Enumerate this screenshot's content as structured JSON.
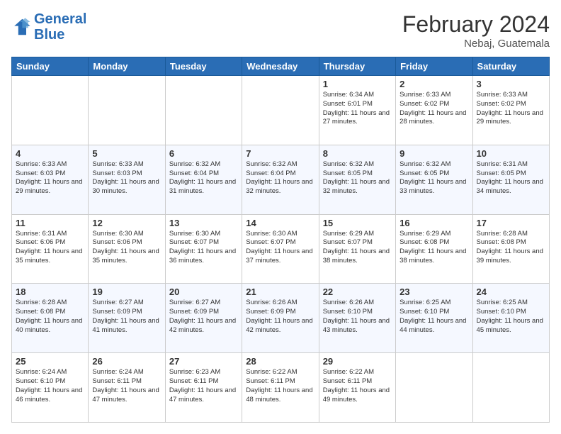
{
  "logo": {
    "line1": "General",
    "line2": "Blue"
  },
  "title": "February 2024",
  "location": "Nebaj, Guatemala",
  "days_of_week": [
    "Sunday",
    "Monday",
    "Tuesday",
    "Wednesday",
    "Thursday",
    "Friday",
    "Saturday"
  ],
  "weeks": [
    [
      {
        "day": "",
        "info": ""
      },
      {
        "day": "",
        "info": ""
      },
      {
        "day": "",
        "info": ""
      },
      {
        "day": "",
        "info": ""
      },
      {
        "day": "1",
        "info": "Sunrise: 6:34 AM\nSunset: 6:01 PM\nDaylight: 11 hours and 27 minutes."
      },
      {
        "day": "2",
        "info": "Sunrise: 6:33 AM\nSunset: 6:02 PM\nDaylight: 11 hours and 28 minutes."
      },
      {
        "day": "3",
        "info": "Sunrise: 6:33 AM\nSunset: 6:02 PM\nDaylight: 11 hours and 29 minutes."
      }
    ],
    [
      {
        "day": "4",
        "info": "Sunrise: 6:33 AM\nSunset: 6:03 PM\nDaylight: 11 hours and 29 minutes."
      },
      {
        "day": "5",
        "info": "Sunrise: 6:33 AM\nSunset: 6:03 PM\nDaylight: 11 hours and 30 minutes."
      },
      {
        "day": "6",
        "info": "Sunrise: 6:32 AM\nSunset: 6:04 PM\nDaylight: 11 hours and 31 minutes."
      },
      {
        "day": "7",
        "info": "Sunrise: 6:32 AM\nSunset: 6:04 PM\nDaylight: 11 hours and 32 minutes."
      },
      {
        "day": "8",
        "info": "Sunrise: 6:32 AM\nSunset: 6:05 PM\nDaylight: 11 hours and 32 minutes."
      },
      {
        "day": "9",
        "info": "Sunrise: 6:32 AM\nSunset: 6:05 PM\nDaylight: 11 hours and 33 minutes."
      },
      {
        "day": "10",
        "info": "Sunrise: 6:31 AM\nSunset: 6:05 PM\nDaylight: 11 hours and 34 minutes."
      }
    ],
    [
      {
        "day": "11",
        "info": "Sunrise: 6:31 AM\nSunset: 6:06 PM\nDaylight: 11 hours and 35 minutes."
      },
      {
        "day": "12",
        "info": "Sunrise: 6:30 AM\nSunset: 6:06 PM\nDaylight: 11 hours and 35 minutes."
      },
      {
        "day": "13",
        "info": "Sunrise: 6:30 AM\nSunset: 6:07 PM\nDaylight: 11 hours and 36 minutes."
      },
      {
        "day": "14",
        "info": "Sunrise: 6:30 AM\nSunset: 6:07 PM\nDaylight: 11 hours and 37 minutes."
      },
      {
        "day": "15",
        "info": "Sunrise: 6:29 AM\nSunset: 6:07 PM\nDaylight: 11 hours and 38 minutes."
      },
      {
        "day": "16",
        "info": "Sunrise: 6:29 AM\nSunset: 6:08 PM\nDaylight: 11 hours and 38 minutes."
      },
      {
        "day": "17",
        "info": "Sunrise: 6:28 AM\nSunset: 6:08 PM\nDaylight: 11 hours and 39 minutes."
      }
    ],
    [
      {
        "day": "18",
        "info": "Sunrise: 6:28 AM\nSunset: 6:08 PM\nDaylight: 11 hours and 40 minutes."
      },
      {
        "day": "19",
        "info": "Sunrise: 6:27 AM\nSunset: 6:09 PM\nDaylight: 11 hours and 41 minutes."
      },
      {
        "day": "20",
        "info": "Sunrise: 6:27 AM\nSunset: 6:09 PM\nDaylight: 11 hours and 42 minutes."
      },
      {
        "day": "21",
        "info": "Sunrise: 6:26 AM\nSunset: 6:09 PM\nDaylight: 11 hours and 42 minutes."
      },
      {
        "day": "22",
        "info": "Sunrise: 6:26 AM\nSunset: 6:10 PM\nDaylight: 11 hours and 43 minutes."
      },
      {
        "day": "23",
        "info": "Sunrise: 6:25 AM\nSunset: 6:10 PM\nDaylight: 11 hours and 44 minutes."
      },
      {
        "day": "24",
        "info": "Sunrise: 6:25 AM\nSunset: 6:10 PM\nDaylight: 11 hours and 45 minutes."
      }
    ],
    [
      {
        "day": "25",
        "info": "Sunrise: 6:24 AM\nSunset: 6:10 PM\nDaylight: 11 hours and 46 minutes."
      },
      {
        "day": "26",
        "info": "Sunrise: 6:24 AM\nSunset: 6:11 PM\nDaylight: 11 hours and 47 minutes."
      },
      {
        "day": "27",
        "info": "Sunrise: 6:23 AM\nSunset: 6:11 PM\nDaylight: 11 hours and 47 minutes."
      },
      {
        "day": "28",
        "info": "Sunrise: 6:22 AM\nSunset: 6:11 PM\nDaylight: 11 hours and 48 minutes."
      },
      {
        "day": "29",
        "info": "Sunrise: 6:22 AM\nSunset: 6:11 PM\nDaylight: 11 hours and 49 minutes."
      },
      {
        "day": "",
        "info": ""
      },
      {
        "day": "",
        "info": ""
      }
    ]
  ]
}
